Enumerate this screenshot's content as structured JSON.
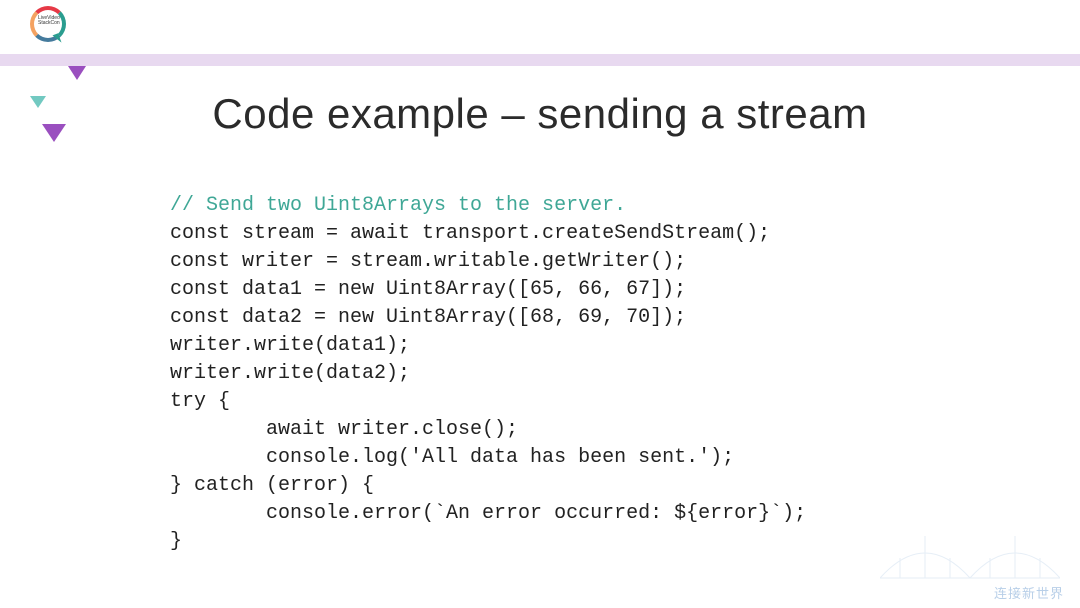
{
  "logo": {
    "label": "LiveVideo StackCon"
  },
  "title": "Code example – sending a stream",
  "code": {
    "comment": "// Send two Uint8Arrays to the server.",
    "lines": [
      "const stream = await transport.createSendStream();",
      "const writer = stream.writable.getWriter();",
      "const data1 = new Uint8Array([65, 66, 67]);",
      "const data2 = new Uint8Array([68, 69, 70]);",
      "writer.write(data1);",
      "writer.write(data2);",
      "try {",
      "        await writer.close();",
      "        console.log('All data has been sent.');",
      "} catch (error) {",
      "        console.error(`An error occurred: ${error}`);",
      "}"
    ]
  },
  "watermark": "连接新世界"
}
